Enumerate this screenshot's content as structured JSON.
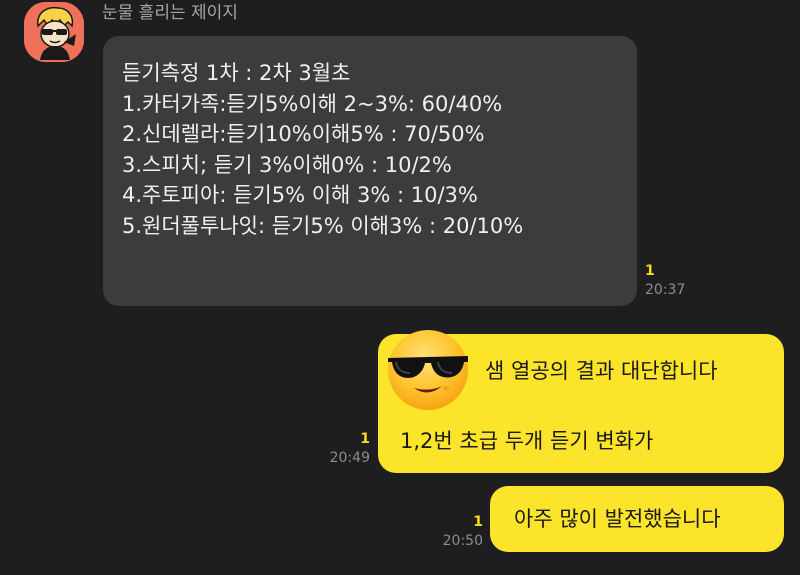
{
  "chat": {
    "sender_name": "눈물 흘리는 제이지",
    "received": {
      "lines": [
        "듣기측정 1차 : 2차 3월초",
        "",
        "1.카터가족:듣기5%이해 2~3%: 60/40%",
        "2.신데렐라:듣기10%이해5% : 70/50%",
        "3.스피치; 듣기 3%이해0% : 10/2%",
        "4.주토피아: 듣기5% 이해 3% : 10/3%",
        "5.원더풀투나잇: 듣기5% 이해3% : 20/10%"
      ],
      "unread": "1",
      "time": "20:37"
    },
    "sent": [
      {
        "lines": [
          "샘 열공의 결과 대단합니다",
          "1,2번 초급 두개 듣기 변화가"
        ],
        "emoticon": "sunglasses-smiley-icon",
        "unread": "1",
        "time": "20:49"
      },
      {
        "lines": [
          "아주 많이 발전했습니다"
        ],
        "unread": "1",
        "time": "20:50"
      }
    ]
  },
  "colors": {
    "background": "#1e1e21",
    "received_bubble": "#3c3c3f",
    "sent_bubble": "#fbe42a",
    "unread_count": "#f5dc19",
    "avatar_bg": "#f0715a"
  }
}
